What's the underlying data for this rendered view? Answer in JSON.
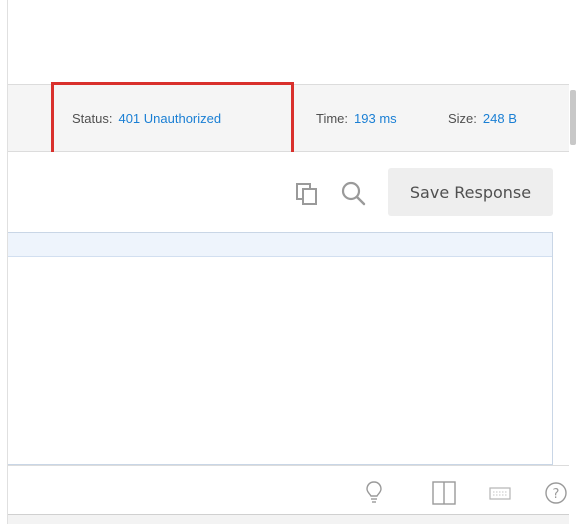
{
  "response_meta": {
    "status_label": "Status:",
    "status_value": "401 Unauthorized",
    "time_label": "Time:",
    "time_value": "193 ms",
    "size_label": "Size:",
    "size_value": "248 B"
  },
  "toolbar": {
    "save_response_label": "Save Response",
    "icons": [
      "copy-icon",
      "search-icon"
    ]
  },
  "footer": {
    "icons": [
      "lightbulb-icon",
      "two-pane-icon",
      "keyboard-icon",
      "help-icon"
    ]
  },
  "colors": {
    "accent": "#1a7fd4",
    "highlight": "#d9302c",
    "label_gray": "#505050"
  }
}
